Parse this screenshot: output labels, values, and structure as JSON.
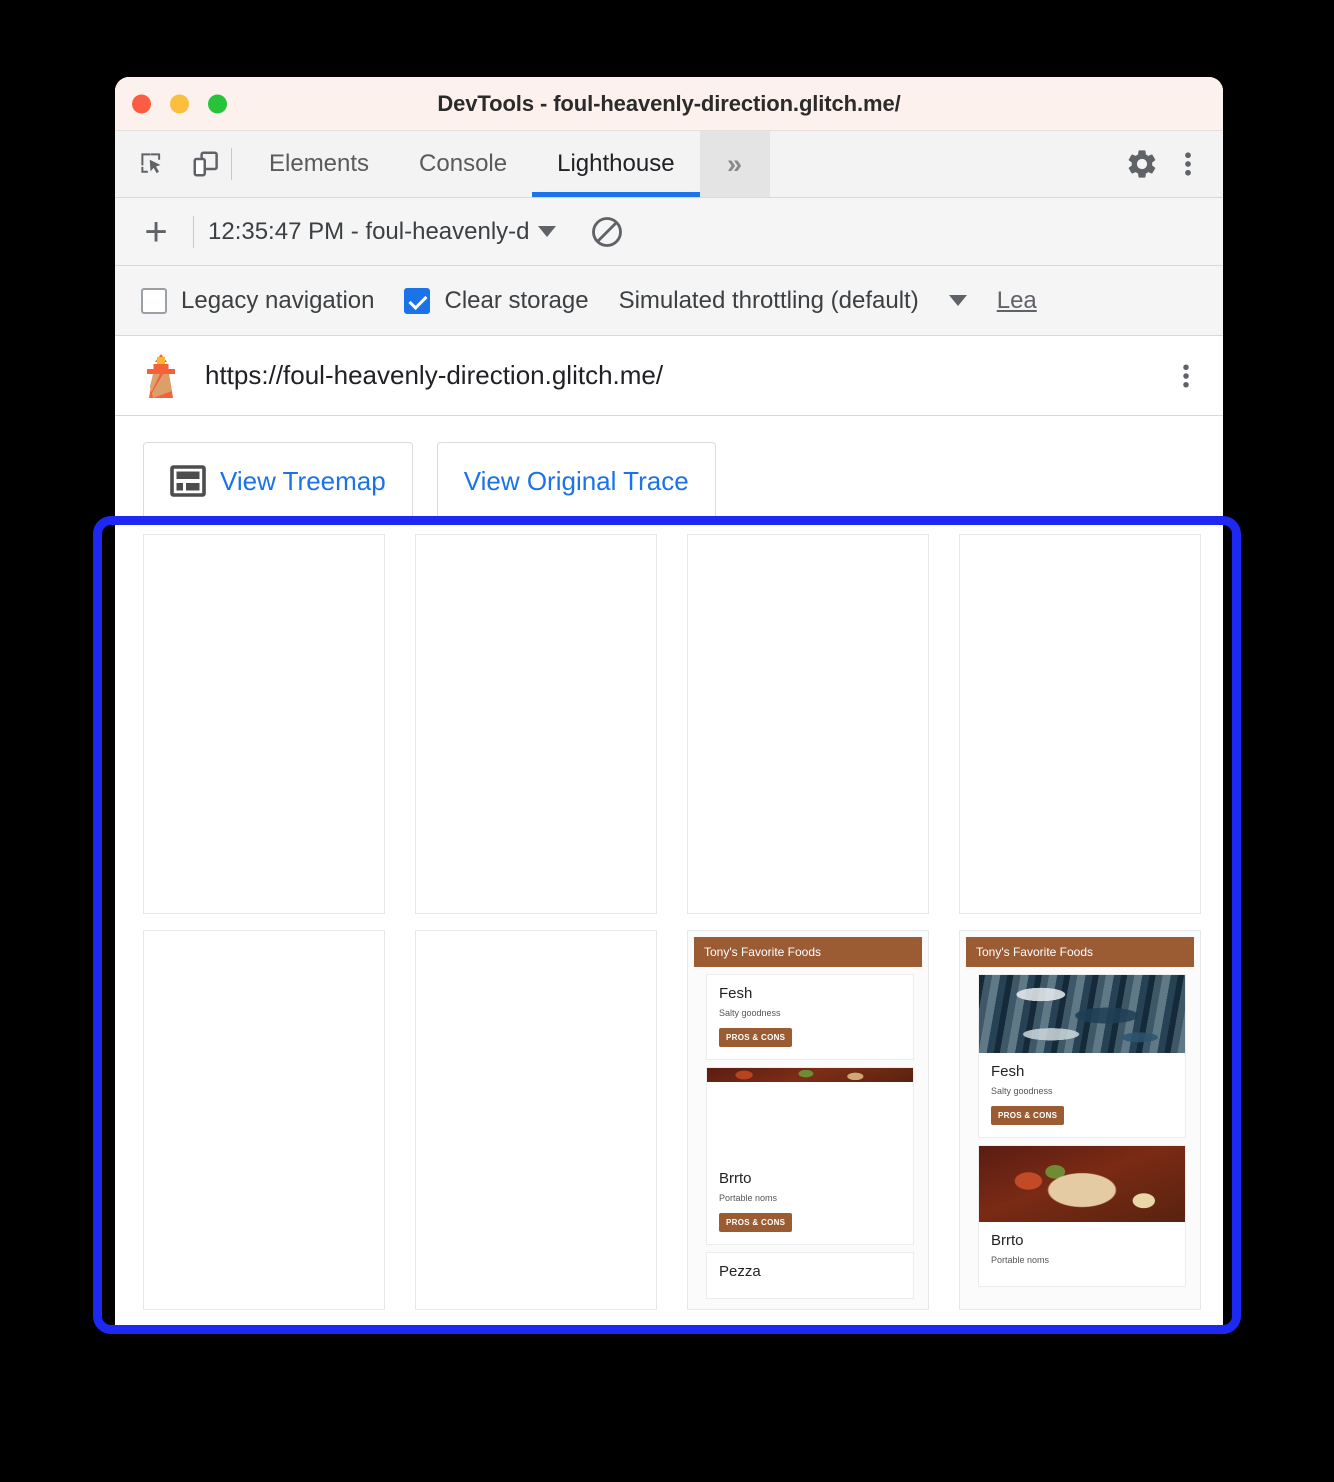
{
  "window": {
    "title": "DevTools - foul-heavenly-direction.glitch.me/",
    "traffic_lights": {
      "close": "close-button",
      "minimize": "minimize-button",
      "maximize": "maximize-button"
    },
    "colors": {
      "titlebar_bg": "#fdf1ee",
      "accent_blue": "#1a73e8",
      "highlight_blue": "#1d28f2",
      "brand_brown": "#9b5c33"
    }
  },
  "tabbar": {
    "inspect_icon": "inspect-element-icon",
    "device_icon": "device-toolbar-icon",
    "tabs": [
      {
        "label": "Elements",
        "selected": false
      },
      {
        "label": "Console",
        "selected": false
      },
      {
        "label": "Lighthouse",
        "selected": true
      }
    ],
    "more_tabs_label": "»",
    "settings_icon": "gear-icon",
    "menu_icon": "kebab-menu-icon"
  },
  "lighthouse_toolbar": {
    "add_label": "+",
    "run_selector_value": "12:35:47 PM - foul-heavenly-d",
    "dropdown_icon": "chevron-down-icon",
    "clear_icon": "clear-all-icon"
  },
  "lighthouse_settings": {
    "legacy_navigation": {
      "label": "Legacy navigation",
      "checked": false
    },
    "clear_storage": {
      "label": "Clear storage",
      "checked": true
    },
    "throttling": {
      "label": "Simulated throttling (default)",
      "dropdown_icon": "chevron-down-icon"
    },
    "learn_more_link": "Lea"
  },
  "report": {
    "lighthouse_icon": "lighthouse-icon",
    "url": "https://foul-heavenly-direction.glitch.me/",
    "menu_icon": "kebab-menu-icon",
    "actions": [
      {
        "label": "View Treemap",
        "icon": "treemap-icon"
      },
      {
        "label": "View Original Trace",
        "icon": ""
      }
    ]
  },
  "filmstrip": {
    "name": "screenshot-filmstrip",
    "frames": [
      {
        "index": 1,
        "state": "blank"
      },
      {
        "index": 2,
        "state": "blank"
      },
      {
        "index": 3,
        "state": "blank"
      },
      {
        "index": 4,
        "state": "blank"
      },
      {
        "index": 5,
        "state": "blank"
      },
      {
        "index": 6,
        "state": "blank"
      },
      {
        "index": 7,
        "state": "partial"
      },
      {
        "index": 8,
        "state": "loaded"
      }
    ],
    "page_mock": {
      "site_header": "Tony's Favorite Foods",
      "cards": [
        {
          "title": "Fesh",
          "subtitle": "Salty goodness",
          "button": "PROS & CONS",
          "image": "fish-photo"
        },
        {
          "title": "Brrto",
          "subtitle": "Portable noms",
          "button": "PROS & CONS",
          "image": "burrito-photo"
        },
        {
          "title": "Pezza",
          "subtitle": "",
          "button": "",
          "image": ""
        }
      ]
    }
  }
}
